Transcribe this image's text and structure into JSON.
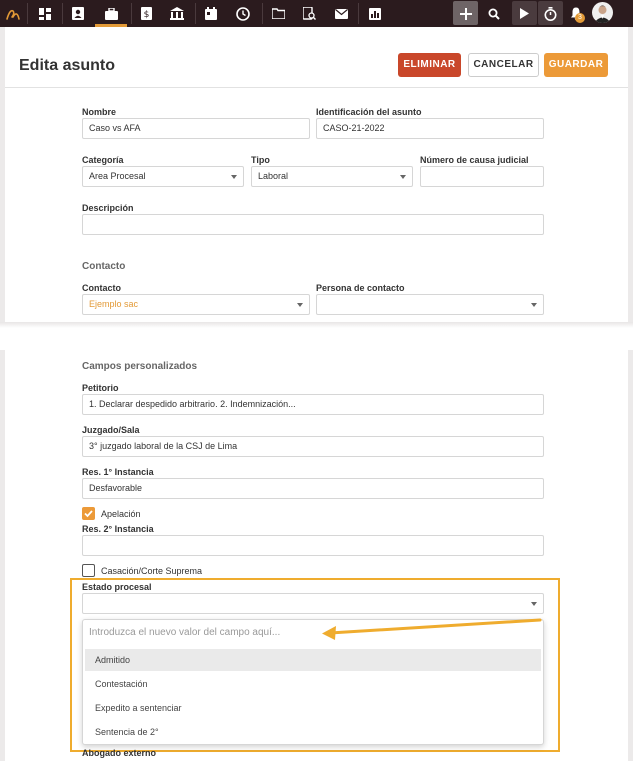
{
  "nav": {
    "icons": [
      "logo-icon",
      "dashboard-icon",
      "contacts-icon",
      "matters-icon",
      "billing-icon",
      "court-icon",
      "calendar-icon",
      "history-icon",
      "folder-icon",
      "document-search-icon",
      "mail-icon",
      "reports-icon",
      "plus-icon",
      "search-icon",
      "play-icon",
      "timer-icon",
      "bell-icon"
    ],
    "notification_count": "3",
    "accent": "#e39a37"
  },
  "header": {
    "title": "Edita asunto",
    "delete_label": "ELIMINAR",
    "cancel_label": "CANCELAR",
    "save_label": "GUARDAR"
  },
  "form": {
    "nombre_label": "Nombre",
    "nombre_value": "Caso vs AFA",
    "id_label": "Identificación del asunto",
    "id_value": "CASO-21-2022",
    "categoria_label": "Categoría",
    "categoria_value": "Area Procesal",
    "tipo_label": "Tipo",
    "tipo_value": "Laboral",
    "causa_label": "Número de causa judicial",
    "causa_value": "",
    "descripcion_label": "Descripción",
    "descripcion_value": ""
  },
  "contacto": {
    "section_title": "Contacto",
    "contacto_label": "Contacto",
    "contacto_value": "Ejemplo sac",
    "persona_label": "Persona de contacto",
    "persona_value": ""
  },
  "custom": {
    "section_title": "Campos personalizados",
    "petitorio_label": "Petitorio",
    "petitorio_value": "1. Declarar despedido arbitrario. 2. Indemnización...",
    "juzgado_label": "Juzgado/Sala",
    "juzgado_value": "3° juzgado laboral de la CSJ de Lima",
    "res1_label": "Res. 1° Instancia",
    "res1_value": "Desfavorable",
    "apelacion_label": "Apelación",
    "apelacion_checked": true,
    "res2_label": "Res. 2° Instancia",
    "res2_value": "",
    "casacion_label": "Casación/Corte Suprema",
    "casacion_checked": false,
    "estado_label": "Estado procesal",
    "estado_value": ""
  },
  "dropdown": {
    "placeholder": "Introduzca el nuevo valor del campo aquí...",
    "options": [
      "Admitido",
      "Contestación",
      "Expedito a sentenciar",
      "Sentencia de 2°"
    ],
    "highlighted": "Admitido"
  },
  "bottom": {
    "abogado_label": "Abogado externo"
  }
}
